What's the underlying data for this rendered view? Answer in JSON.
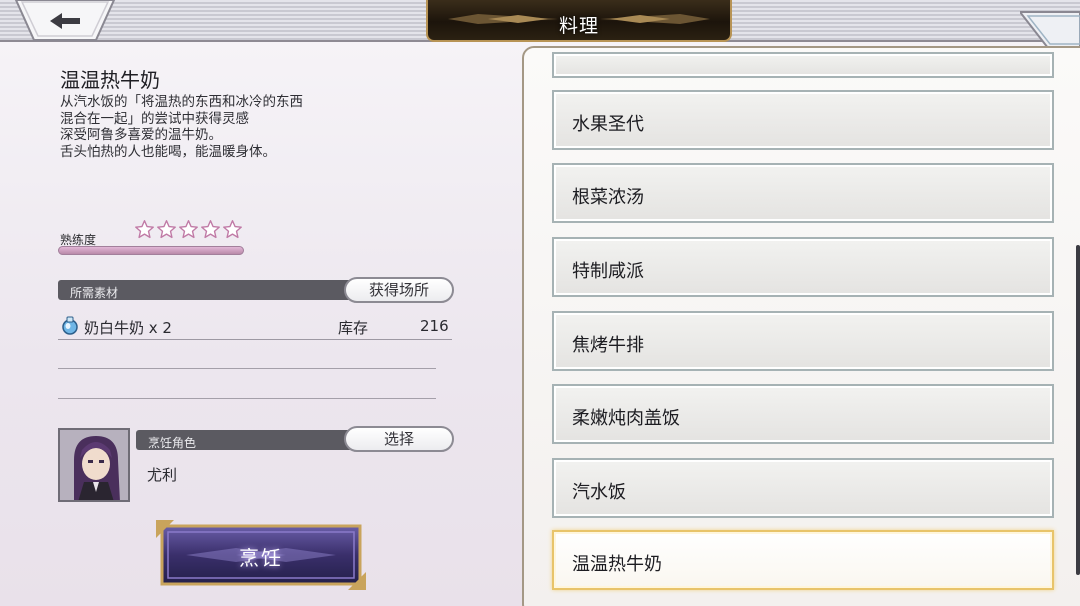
{
  "header": {
    "title": "料理"
  },
  "item": {
    "name": "温温热牛奶",
    "description_lines": [
      "从汽水饭的「将温热的东西和冰冷的东西",
      "混合在一起」的尝试中获得灵感",
      "深受阿鲁多喜爱的温牛奶。",
      "舌头怕热的人也能喝，能温暖身体。"
    ]
  },
  "proficiency": {
    "label": "熟练度",
    "stars_total": 5,
    "stars_filled": 0
  },
  "materials": {
    "section_label": "所需素材",
    "obtain_button": "获得场所",
    "items": [
      {
        "name": "奶白牛奶 x 2",
        "stock_label": "库存",
        "stock": "216",
        "icon": "milk-bottle-icon"
      }
    ]
  },
  "cook": {
    "section_label": "烹饪角色",
    "select_button": "选择",
    "character_name": "尤利",
    "action_button": "烹饪"
  },
  "recipes": {
    "items": [
      {
        "label": "水果圣代",
        "selected": false
      },
      {
        "label": "根菜浓汤",
        "selected": false
      },
      {
        "label": "特制咸派",
        "selected": false
      },
      {
        "label": "焦烤牛排",
        "selected": false
      },
      {
        "label": "柔嫩炖肉盖饭",
        "selected": false
      },
      {
        "label": "汽水饭",
        "selected": false
      },
      {
        "label": "温温热牛奶",
        "selected": true
      }
    ]
  },
  "colors": {
    "selected_border": "#e8c46a",
    "title_plate": "#1c140b",
    "cook_button": "#3a2f6b"
  }
}
